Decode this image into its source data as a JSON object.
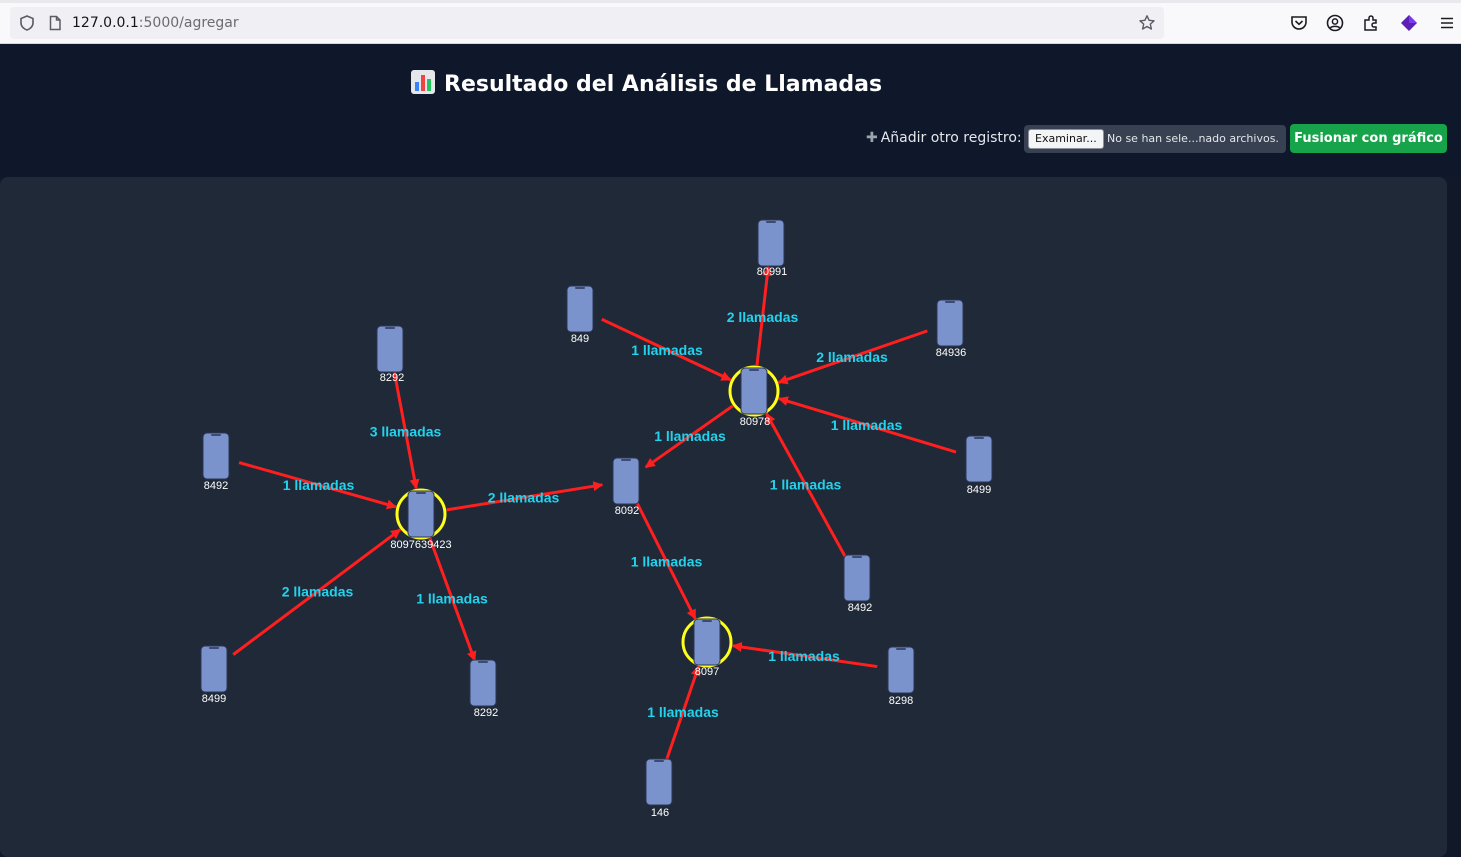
{
  "browser": {
    "url_host": "127.0.0.1",
    "url_path": ":5000/agregar",
    "icons": [
      "shield-icon",
      "page-icon",
      "bookmark-star-icon",
      "pocket-icon",
      "account-icon",
      "extensions-icon",
      "extension-purple-icon",
      "menu-icon"
    ]
  },
  "header": {
    "title_icon": "bar-chart-icon",
    "title": "Resultado del Análisis de Llamadas",
    "add_label": "Añadir otro registro:",
    "file_button": "Examinar...",
    "file_status": "No se han sele...nado archivos.",
    "merge_button": "Fusionar con gráfico"
  },
  "colors": {
    "page_bg": "#111827",
    "header_bg": "#0f172a",
    "panel_bg": "#1f2937",
    "edge": "#ff1f1f",
    "edge_label": "#22d3ee",
    "node": "#7b93cc",
    "hub_ring": "#ffff1a",
    "merge_button": "#16a34a"
  },
  "graph": {
    "nodes": [
      {
        "id": "n1",
        "label": "80991",
        "hub": false
      },
      {
        "id": "n2",
        "label": "849",
        "hub": false
      },
      {
        "id": "n3",
        "label": "84936",
        "hub": false
      },
      {
        "id": "n4",
        "label": "80978",
        "hub": true
      },
      {
        "id": "n5",
        "label": "8292",
        "hub": false
      },
      {
        "id": "n6",
        "label": "8492",
        "hub": false
      },
      {
        "id": "n7",
        "label": "8092",
        "hub": false
      },
      {
        "id": "n8",
        "label": "8499",
        "hub": false
      },
      {
        "id": "n9",
        "label": "8097639423",
        "hub": true
      },
      {
        "id": "n10",
        "label": "8492",
        "hub": false
      },
      {
        "id": "n11",
        "label": "8499",
        "hub": false
      },
      {
        "id": "n12",
        "label": "8097",
        "hub": true
      },
      {
        "id": "n13",
        "label": "8298",
        "hub": false
      },
      {
        "id": "n14",
        "label": "8292",
        "hub": false
      },
      {
        "id": "n15",
        "label": "146",
        "hub": false
      }
    ],
    "edges": [
      {
        "from": "n4",
        "to": "n1",
        "label": "2 llamadas"
      },
      {
        "from": "n2",
        "to": "n4",
        "label": "1 llamadas"
      },
      {
        "from": "n3",
        "to": "n4",
        "label": "2 llamadas"
      },
      {
        "from": "n8",
        "to": "n4",
        "label": "1 llamadas"
      },
      {
        "from": "n4",
        "to": "n7",
        "label": "1 llamadas"
      },
      {
        "from": "n10",
        "to": "n4",
        "label": "1 llamadas"
      },
      {
        "from": "n5",
        "to": "n9",
        "label": "3 llamadas"
      },
      {
        "from": "n6",
        "to": "n9",
        "label": "1 llamadas"
      },
      {
        "from": "n9",
        "to": "n7",
        "label": "2 llamadas"
      },
      {
        "from": "n11",
        "to": "n9",
        "label": "2 llamadas"
      },
      {
        "from": "n9",
        "to": "n14",
        "label": "1 llamadas"
      },
      {
        "from": "n7",
        "to": "n12",
        "label": "1 llamadas"
      },
      {
        "from": "n13",
        "to": "n12",
        "label": "1 llamadas"
      },
      {
        "from": "n15",
        "to": "n12",
        "label": "1 llamadas"
      }
    ]
  }
}
